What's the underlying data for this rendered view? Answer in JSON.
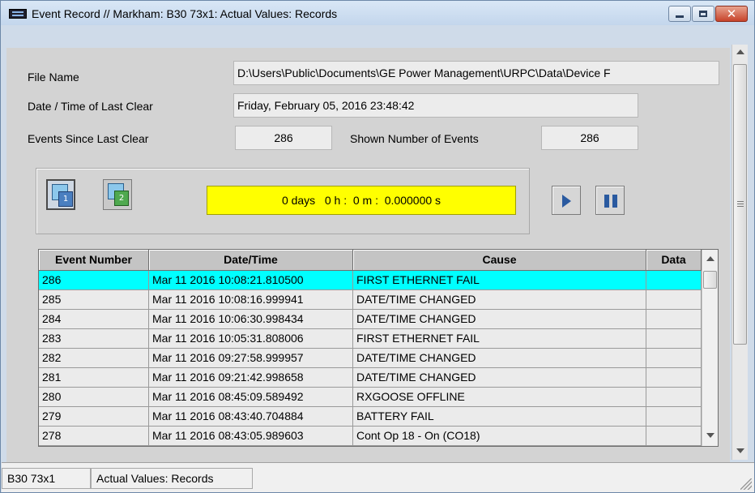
{
  "window": {
    "title": "Event Record // Markham: B30 73x1: Actual Values: Records",
    "close_glyph": "✕"
  },
  "form": {
    "file_name_label": "File Name",
    "file_name_value": "D:\\Users\\Public\\Documents\\GE Power Management\\URPC\\Data\\Device F",
    "last_clear_label": "Date / Time of Last Clear",
    "last_clear_value": "Friday, February 05, 2016 23:48:42",
    "events_since_label": "Events Since Last Clear",
    "events_since_value": "286",
    "shown_events_label": "Shown Number of Events",
    "shown_events_value": "286"
  },
  "controls": {
    "record1_digit": "1",
    "record2_digit": "2",
    "timer_text": "0 days   0 h :  0 m :  0.000000 s"
  },
  "table": {
    "columns": [
      "Event Number",
      "Date/Time",
      "Cause",
      "Data"
    ],
    "rows": [
      {
        "num": "286",
        "datetime": "Mar 11 2016 10:08:21.810500",
        "cause": "FIRST ETHERNET FAIL",
        "data": ""
      },
      {
        "num": "285",
        "datetime": "Mar 11 2016 10:08:16.999941",
        "cause": "DATE/TIME CHANGED",
        "data": ""
      },
      {
        "num": "284",
        "datetime": "Mar 11 2016 10:06:30.998434",
        "cause": "DATE/TIME CHANGED",
        "data": ""
      },
      {
        "num": "283",
        "datetime": "Mar 11 2016 10:05:31.808006",
        "cause": "FIRST ETHERNET FAIL",
        "data": ""
      },
      {
        "num": "282",
        "datetime": "Mar 11 2016 09:27:58.999957",
        "cause": "DATE/TIME CHANGED",
        "data": ""
      },
      {
        "num": "281",
        "datetime": "Mar 11 2016 09:21:42.998658",
        "cause": "DATE/TIME CHANGED",
        "data": ""
      },
      {
        "num": "280",
        "datetime": "Mar 11 2016 08:45:09.589492",
        "cause": "RXGOOSE OFFLINE",
        "data": ""
      },
      {
        "num": "279",
        "datetime": "Mar 11 2016 08:43:40.704884",
        "cause": "BATTERY FAIL",
        "data": ""
      },
      {
        "num": "278",
        "datetime": "Mar 11 2016 08:43:05.989603",
        "cause": "Cont Op 18 - On (CO18)",
        "data": ""
      }
    ],
    "selected_row": 0
  },
  "statusbar": {
    "device": "B30 73x1",
    "view": "Actual Values: Records"
  },
  "colors": {
    "selection": "#00ffff",
    "timer_background": "#ffff00",
    "client_background": "#d3d3d3"
  }
}
